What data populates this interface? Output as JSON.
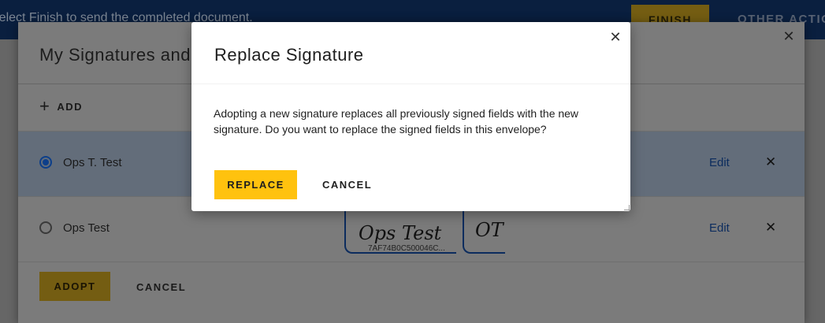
{
  "topbar": {
    "message": "Select Finish to send the completed document.",
    "finish_label": "FINISH",
    "other_actions_label": "OTHER ACTIONS"
  },
  "signatures_modal": {
    "title": "My Signatures and Initials",
    "add_label": "ADD",
    "rows": [
      {
        "name": "Ops T. Test",
        "edit_label": "Edit",
        "selected": true
      },
      {
        "name": "Ops Test",
        "edit_label": "Edit",
        "selected": false,
        "signature_text": "Ops Test",
        "initials_text": "OT",
        "signature_id": "7AF74B0C500046C..."
      }
    ],
    "adopt_label": "ADOPT",
    "cancel_label": "CANCEL"
  },
  "replace_dialog": {
    "title": "Replace Signature",
    "body": "Adopting a new signature replaces all previously signed fields with the new signature. Do you want to replace the signed fields in this envelope?",
    "replace_label": "REPLACE",
    "cancel_label": "CANCEL"
  },
  "icons": {
    "close": "close-icon",
    "add": "plus-icon",
    "delete": "delete-icon"
  },
  "colors": {
    "accent_yellow": "#ffc20e",
    "link_blue": "#1a5fb4",
    "radio_blue": "#1f6fe0"
  }
}
